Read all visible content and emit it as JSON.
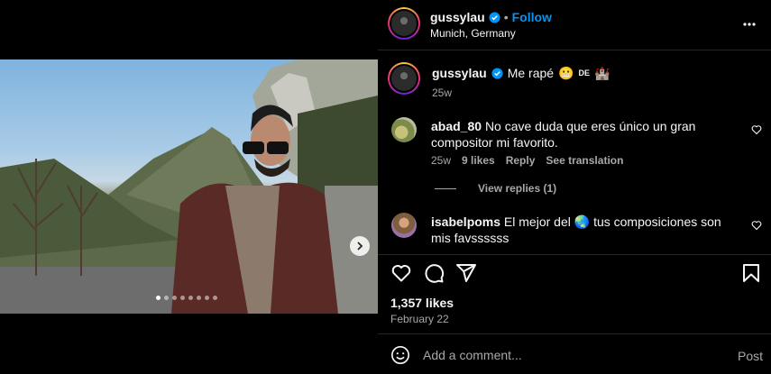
{
  "post": {
    "username": "gussylau",
    "follow_label": "Follow",
    "location": "Munich, Germany",
    "more_icon": "more-horizontal-icon",
    "caption": {
      "username": "gussylau",
      "text": "Me rapé",
      "emoji1": "😬",
      "flag": "DE",
      "emoji2": "🏰",
      "time": "25w"
    },
    "media": {
      "carousel_count": 8,
      "active_index": 0
    }
  },
  "comments": [
    {
      "username": "abad_80",
      "text": "No cave duda que eres único un gran compositor mi favorito.",
      "time": "25w",
      "likes": "9 likes",
      "reply_label": "Reply",
      "translate_label": "See translation",
      "view_replies": "View replies (1)"
    },
    {
      "username": "isabelpoms",
      "text_before": "El mejor del",
      "emoji": "🌏",
      "text_after": "tus composiciones son mis favssssss"
    }
  ],
  "actions": {
    "likes": "1,357 likes",
    "date": "February 22"
  },
  "composer": {
    "placeholder": "Add a comment...",
    "post_label": "Post"
  },
  "colors": {
    "accent": "#0095f6",
    "verified": "#0095f6",
    "muted": "#a8a8a8",
    "divider": "#262626"
  }
}
